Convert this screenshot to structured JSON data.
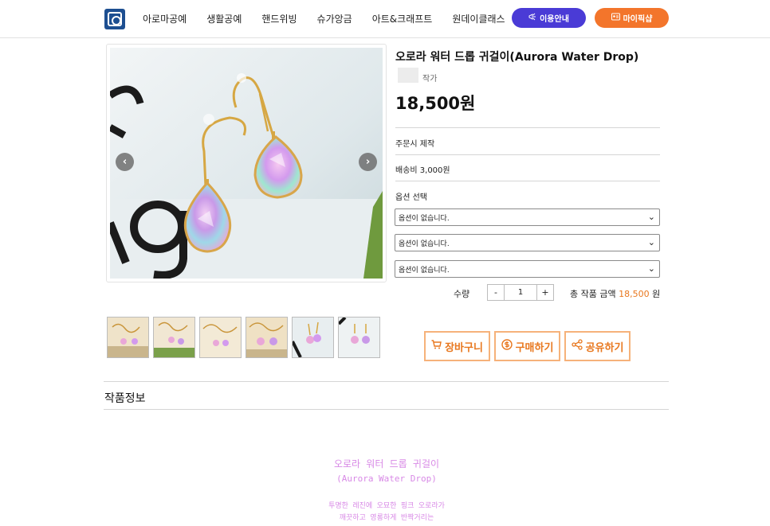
{
  "header": {
    "nav": [
      "아로마공예",
      "생활공예",
      "핸드위빙",
      "슈가앙금",
      "아트&크래프트",
      "원데이클래스"
    ],
    "guide_label": "이용안내",
    "mypage_label": "마이픽샵"
  },
  "product": {
    "title": "오로라 워터 드롭 귀걸이(Aurora Water Drop)",
    "author_label": "작가",
    "price": "18,500원",
    "made_to_order": "주문시 제작",
    "shipping": "배송비 3,000원",
    "option_label": "옵션 선택",
    "options": [
      "옵션이 없습니다.",
      "옵션이 없습니다.",
      "옵션이 없습니다."
    ],
    "quantity_label": "수량",
    "quantity_minus": "-",
    "quantity": "1",
    "quantity_plus": "+",
    "total_label": "총 작품 금액",
    "total_amount": "18,500",
    "total_unit": "원"
  },
  "carousel": {
    "prev": "‹",
    "next": "›"
  },
  "actions": {
    "cart": "장바구니",
    "buy": "구매하기",
    "share": "공유하기"
  },
  "section": {
    "title": "작품정보"
  },
  "description": {
    "title": "오로라 워터 드롭 귀걸이",
    "subtitle": "(Aurora Water Drop)",
    "lines": [
      "투명한 레진에 오묘한 핑크 오로라가",
      "깨끗하고 영롱하게 반짝거리는"
    ]
  },
  "colors": {
    "guide_button": "#4a3bd6",
    "mypage_button": "#f3752b",
    "accent": "#e8771e",
    "description_text": "#d889e6"
  }
}
